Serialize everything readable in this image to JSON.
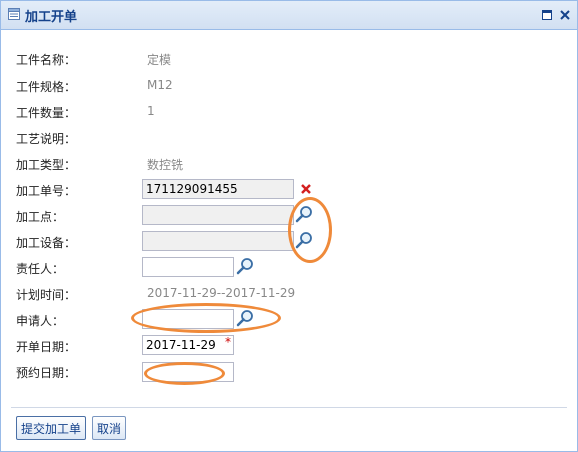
{
  "window": {
    "title": "加工开单",
    "maximize_icon": "maximize-icon",
    "close_icon": "close-icon"
  },
  "form": {
    "part_name": {
      "label": "工件名称：",
      "value": "定模"
    },
    "part_spec": {
      "label": "工件规格：",
      "value": "M12"
    },
    "part_qty": {
      "label": "工件数量：",
      "value": "1"
    },
    "process_desc": {
      "label": "工艺说明：",
      "value": ""
    },
    "process_type": {
      "label": "加工类型：",
      "value": "数控铣"
    },
    "order_no": {
      "label": "加工单号：",
      "value": "171129091455"
    },
    "location": {
      "label": "加工点：",
      "value": ""
    },
    "equipment": {
      "label": "加工设备：",
      "value": ""
    },
    "owner": {
      "label": "责任人：",
      "value": ""
    },
    "plan_time": {
      "label": "计划时间：",
      "value": "2017-11-29--2017-11-29"
    },
    "applicant": {
      "label": "申请人：",
      "value": ""
    },
    "open_date": {
      "label": "开单日期：",
      "value": "2017-11-29",
      "required_mark": "*"
    },
    "booking_date": {
      "label": "预约日期：",
      "value": ""
    }
  },
  "buttons": {
    "submit": "提交加工单",
    "cancel": "取消"
  },
  "colors": {
    "title_text": "#15428b",
    "border": "#99bbe8",
    "annotation": "#ef8a3a",
    "required": "#cc0000"
  }
}
